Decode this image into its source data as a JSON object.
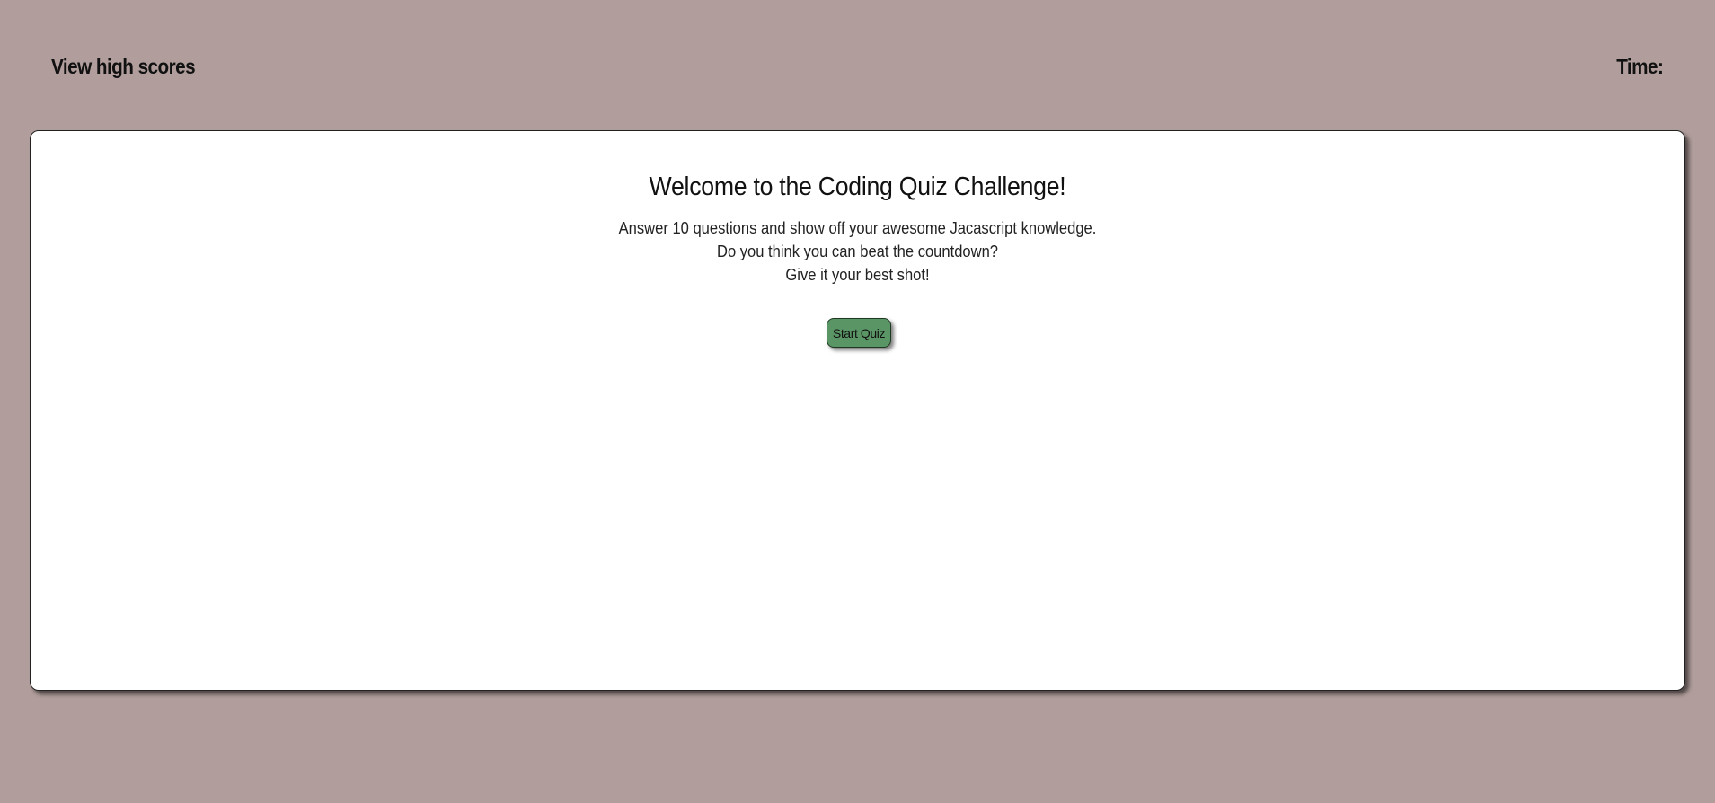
{
  "header": {
    "high_scores_label": "View high scores",
    "timer_label": "Time:",
    "timer_value": ""
  },
  "welcome": {
    "title": "Welcome to the Coding Quiz Challenge!",
    "lines": [
      "Answer 10 questions and show off your awesome Jacascript knowledge.",
      "Do you think you can beat the countdown?",
      "Give it your best shot!"
    ],
    "start_label": "Start Quiz"
  },
  "colors": {
    "page_background": "#b19e9c",
    "card_background": "#ffffff",
    "start_button": "#5a9566"
  }
}
